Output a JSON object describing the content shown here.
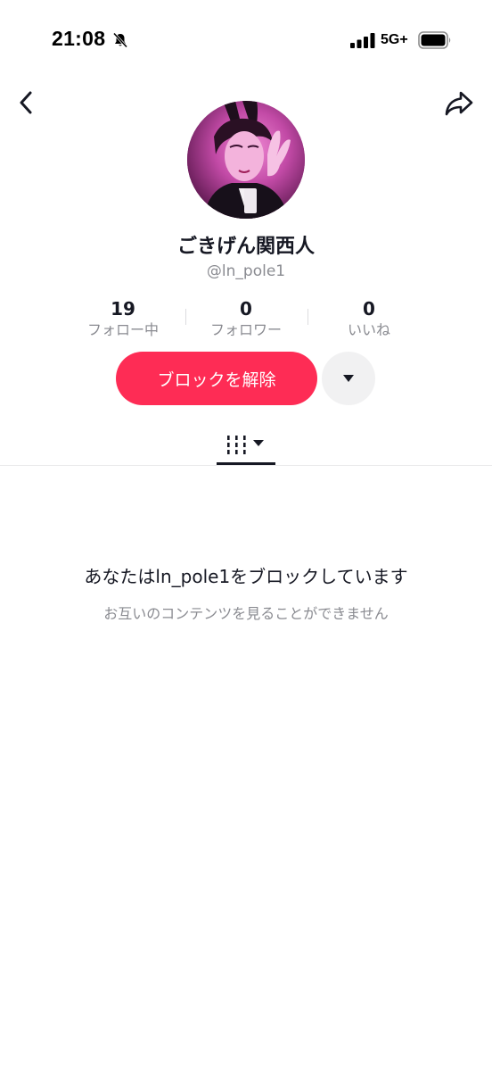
{
  "status_bar": {
    "time": "21:08",
    "network": "5G+",
    "icons": [
      "bell-muted-icon",
      "signal-icon",
      "battery-icon"
    ]
  },
  "nav": {
    "back_icon": "chevron-left-icon",
    "share_icon": "share-arrow-icon"
  },
  "profile": {
    "display_name": "ごきげん関西人",
    "handle": "@ln_pole1"
  },
  "stats": [
    {
      "value": "19",
      "label": "フォロー中"
    },
    {
      "value": "0",
      "label": "フォロワー"
    },
    {
      "value": "0",
      "label": "いいね"
    }
  ],
  "actions": {
    "unblock_label": "ブロックを解除",
    "more_icon": "caret-down-icon"
  },
  "tabs": {
    "active_icon": "grid-columns-icon"
  },
  "blocked": {
    "title": "あなたはln_pole1をブロックしています",
    "subtitle": "お互いのコンテンツを見ることができません"
  },
  "colors": {
    "accent": "#fe2c55",
    "text_primary": "#161823",
    "text_secondary": "#8a8b91"
  }
}
